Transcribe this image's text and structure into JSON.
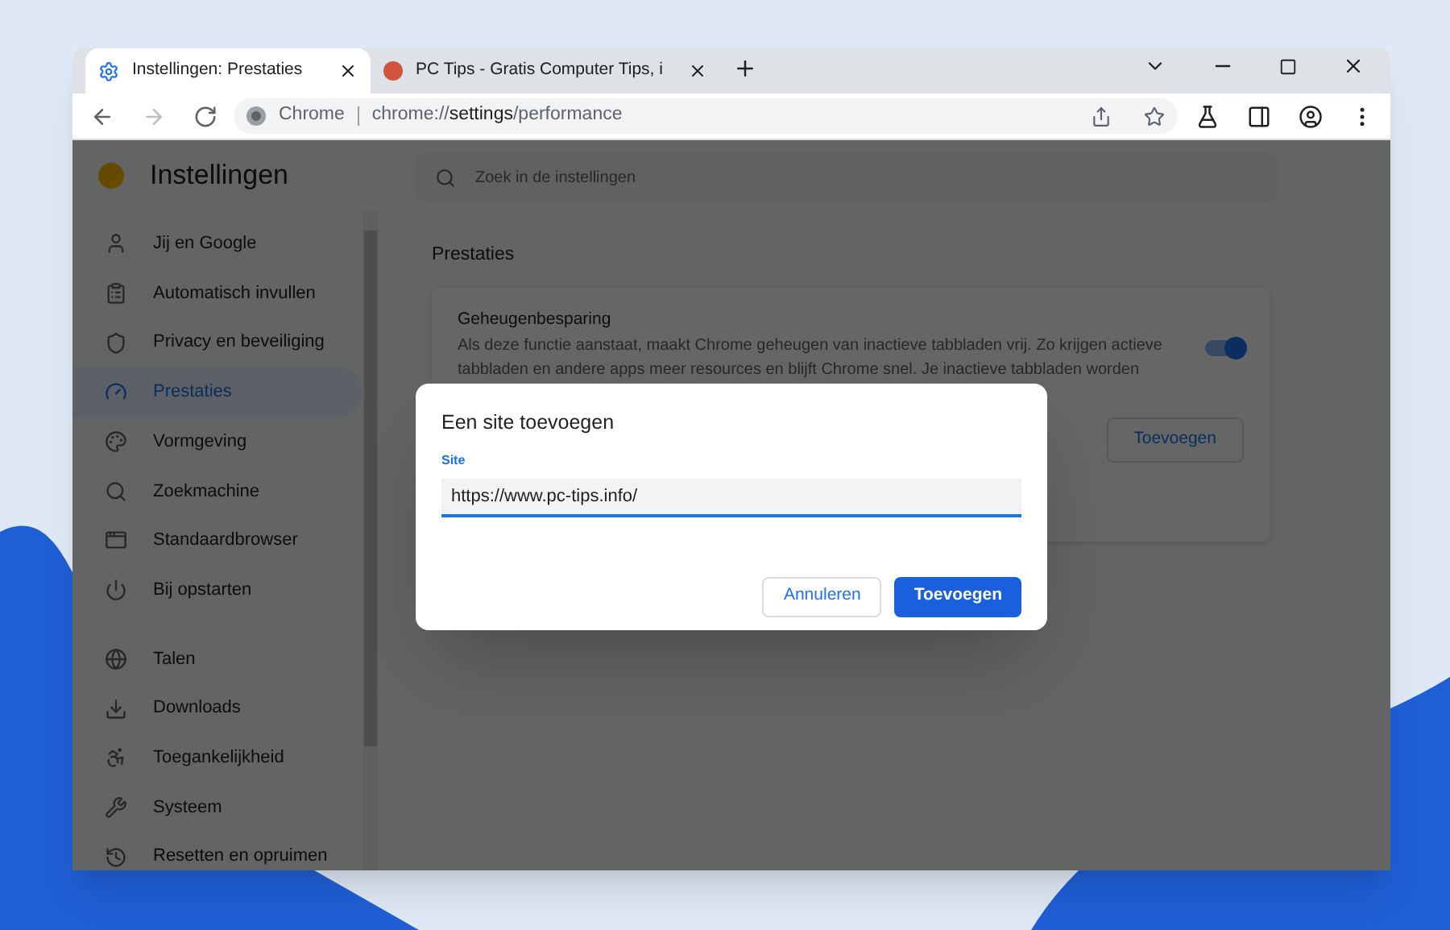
{
  "tabs": [
    {
      "title": "Instellingen: Prestaties",
      "selected": true
    },
    {
      "title": "PC Tips - Gratis Computer Tips, i",
      "selected": false
    }
  ],
  "toolbar": {
    "site_chip": "Chrome",
    "url_host": "chrome://",
    "url_path": "settings",
    "url_rest": "/performance"
  },
  "sidebar": {
    "title": "Instellingen",
    "sections": [
      [
        {
          "label": "Jij en Google",
          "selected": false
        },
        {
          "label": "Automatisch invullen",
          "selected": false
        },
        {
          "label": "Privacy en beveiliging",
          "selected": false
        },
        {
          "label": "Prestaties",
          "selected": true
        },
        {
          "label": "Vormgeving",
          "selected": false
        },
        {
          "label": "Zoekmachine",
          "selected": false
        },
        {
          "label": "Standaardbrowser",
          "selected": false
        },
        {
          "label": "Bij opstarten",
          "selected": false
        }
      ],
      [
        {
          "label": "Talen",
          "selected": false
        },
        {
          "label": "Downloads",
          "selected": false
        },
        {
          "label": "Toegankelijkheid",
          "selected": false
        },
        {
          "label": "Systeem",
          "selected": false
        },
        {
          "label": "Resetten en opruimen",
          "selected": false
        }
      ]
    ]
  },
  "search": {
    "placeholder": "Zoek in de instellingen"
  },
  "section_title": "Prestaties",
  "card": {
    "title": "Geheugenbesparing",
    "description": "Als deze functie aanstaat, maakt Chrome geheugen van inactieve tabbladen vrij. Zo krijgen actieve tabbladen en andere apps meer resources en blijft Chrome snel. Je inactieve tabbladen worden",
    "on": true,
    "button": "Toevoegen"
  },
  "dialog": {
    "title": "Een site toevoegen",
    "field_label": "Site",
    "field_value": "https://www.pc-tips.info/",
    "cancel": "Annuleren",
    "confirm": "Toevoegen"
  }
}
